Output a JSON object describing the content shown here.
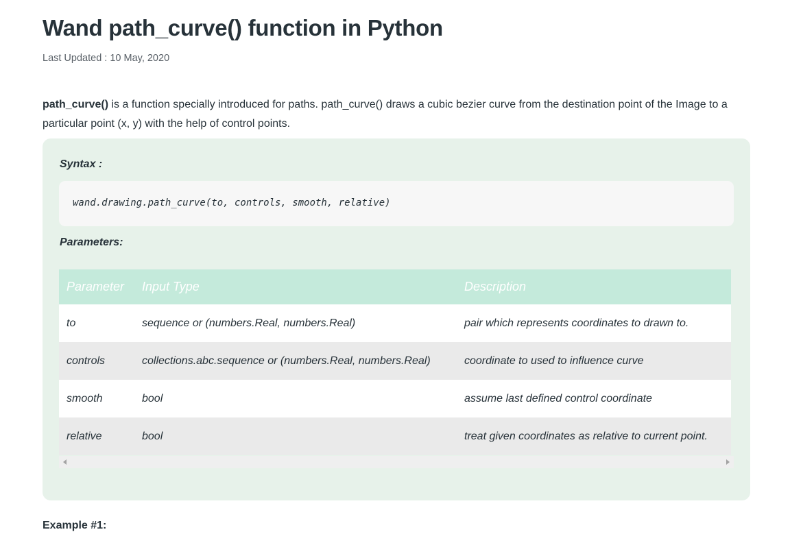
{
  "article": {
    "title": "Wand path_curve() function in Python",
    "last_updated": "Last Updated : 10 May, 2020",
    "intro_bold": "path_curve()",
    "intro_rest": " is a function specially introduced for paths. path_curve() draws a cubic bezier curve from the destination point of the Image to a particular point (x, y) with the help of control points."
  },
  "syntax": {
    "label": "Syntax :",
    "code": "wand.drawing.path_curve(to, controls, smooth, relative)"
  },
  "parameters": {
    "label": "Parameters:",
    "headers": [
      "Parameter",
      "Input Type",
      "Description"
    ],
    "rows": [
      {
        "param": "to",
        "type": "sequence or (numbers.Real, numbers.Real)",
        "desc": "pair which represents coordinates to drawn to."
      },
      {
        "param": "controls",
        "type": "collections.abc.sequence or (numbers.Real, numbers.Real)",
        "desc": "coordinate to used to influence curve"
      },
      {
        "param": "smooth",
        "type": "bool",
        "desc": "assume last defined control coordinate"
      },
      {
        "param": "relative",
        "type": "bool",
        "desc": "treat given coordinates as relative to current point."
      }
    ]
  },
  "example": {
    "heading": "Example #1:"
  },
  "colors": {
    "syntax_box_bg": "#e7f2ea",
    "table_header_bg": "#c4eadb",
    "row_alt_bg": "#eaeaea",
    "text": "#273239"
  }
}
